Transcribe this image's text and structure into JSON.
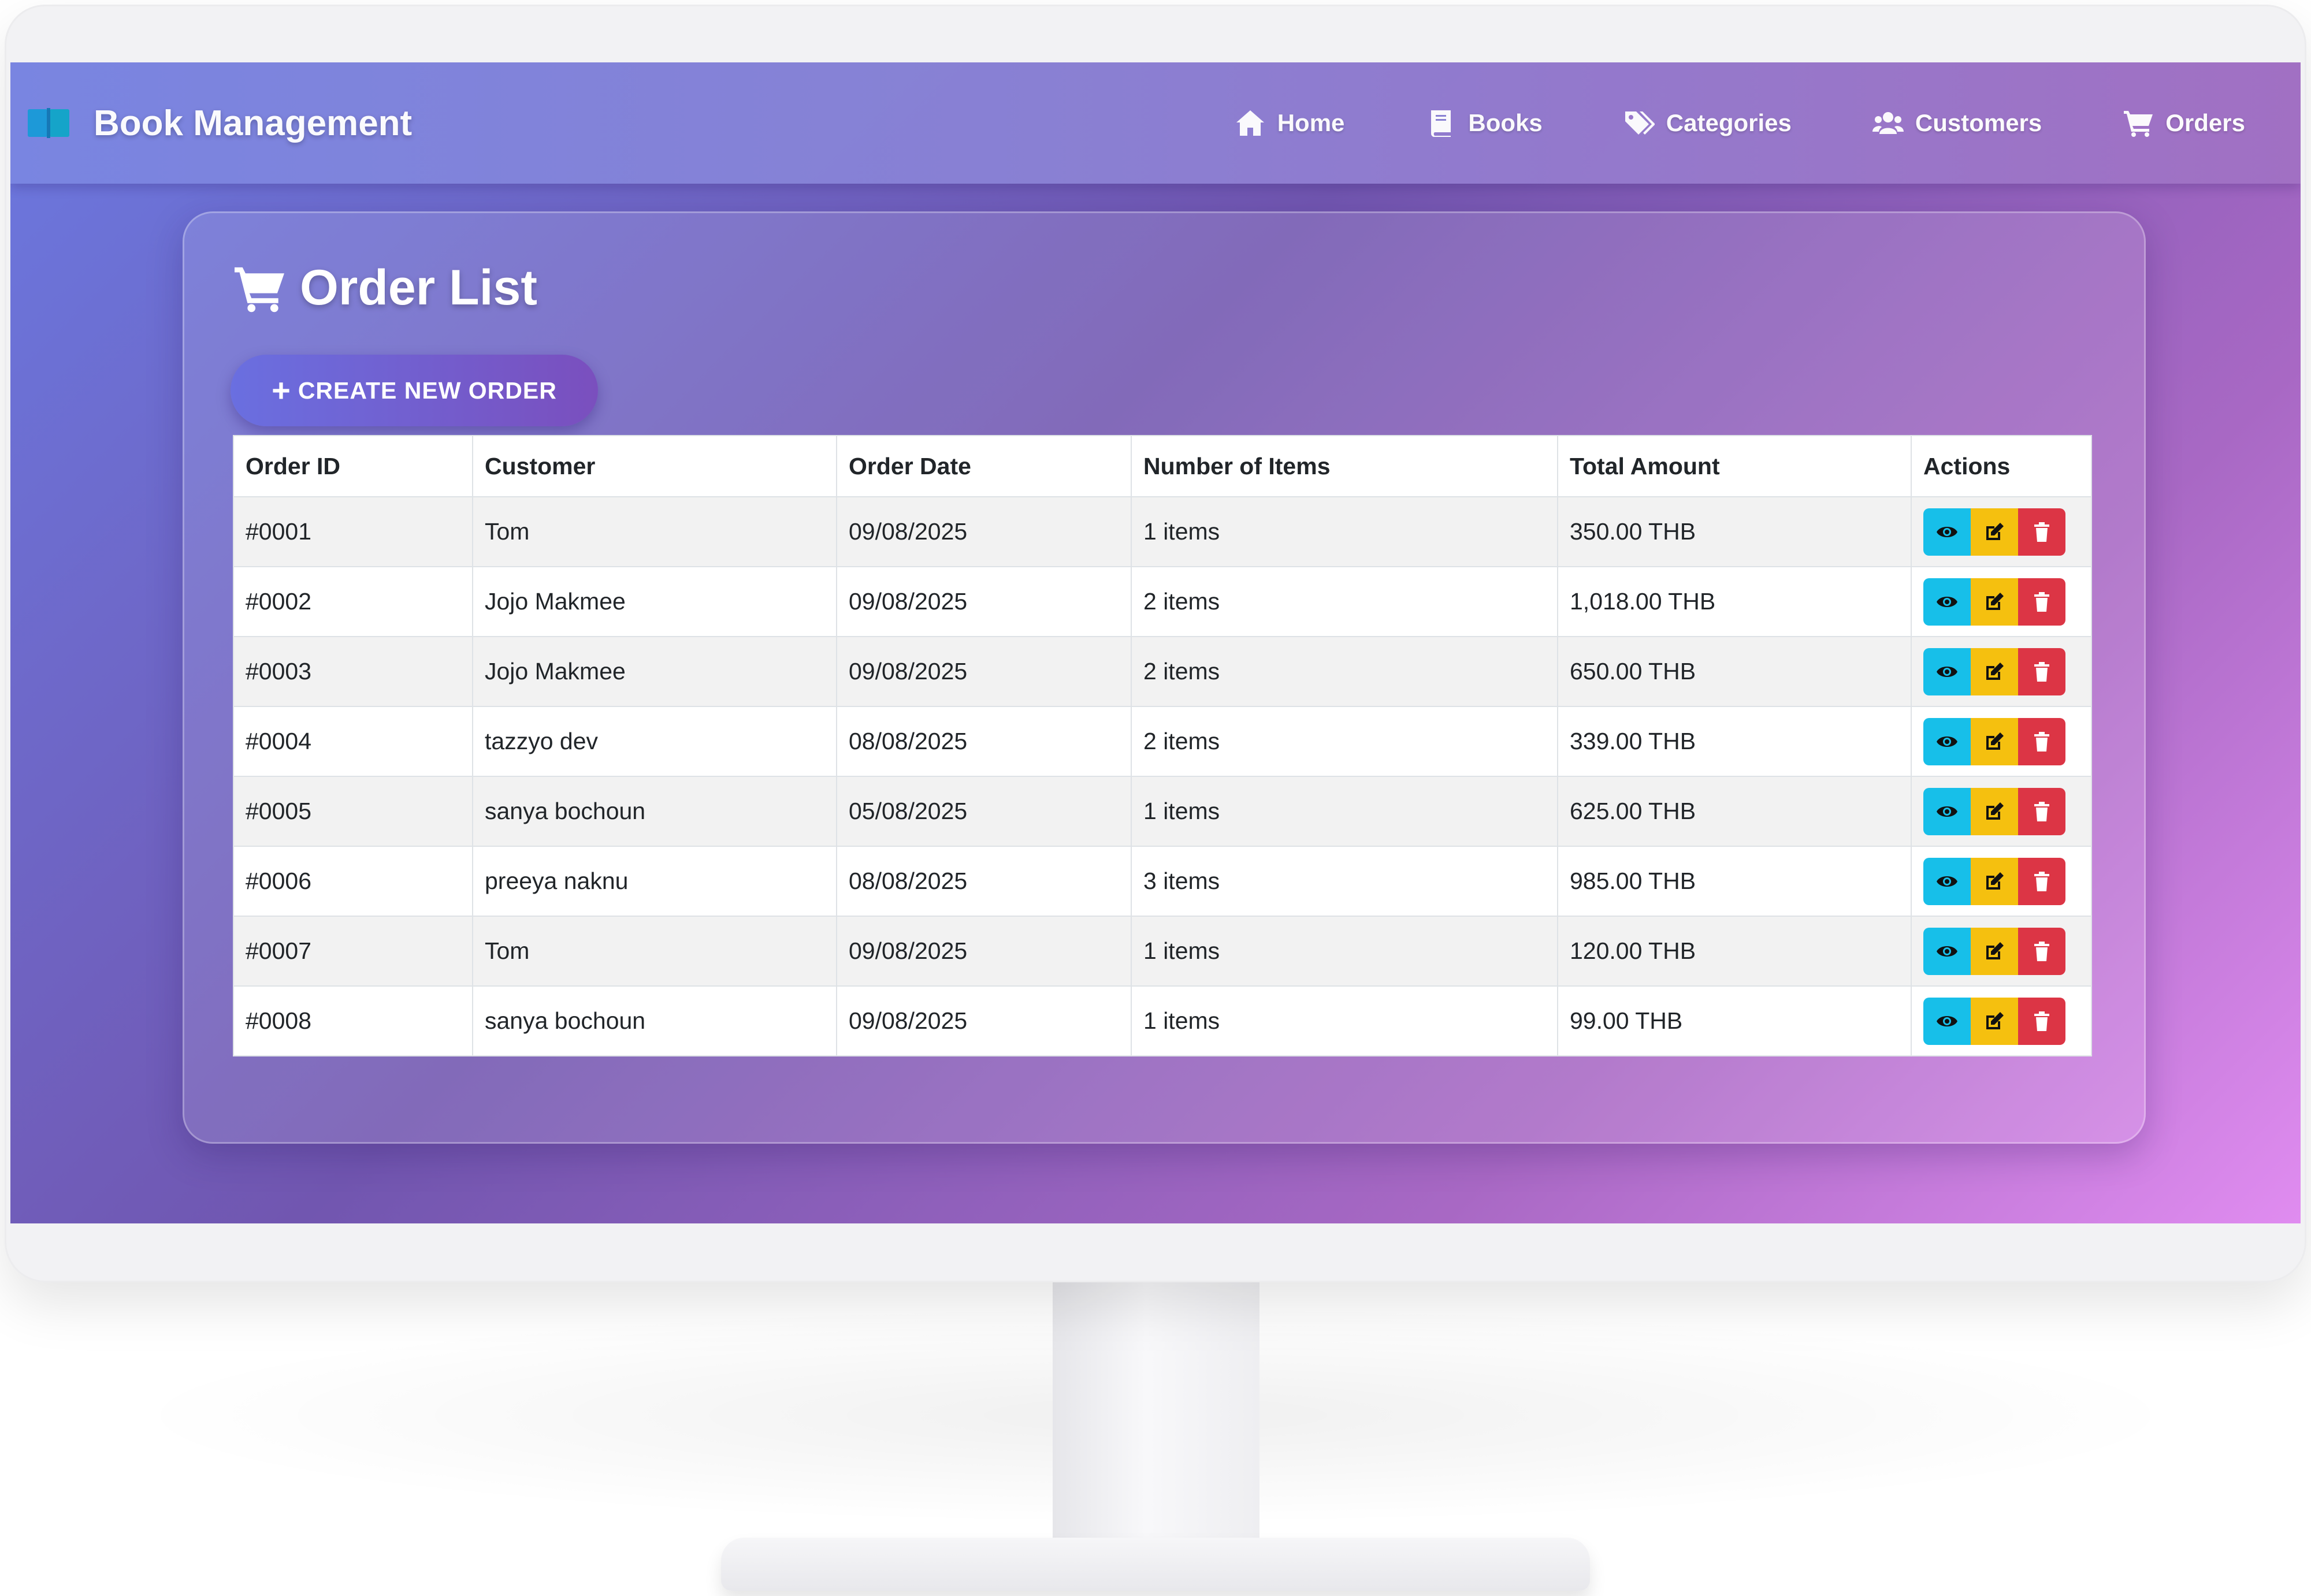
{
  "app": {
    "brand": "Book Management"
  },
  "nav": {
    "items": [
      {
        "label": "Home",
        "icon": "home-icon"
      },
      {
        "label": "Books",
        "icon": "book-icon"
      },
      {
        "label": "Categories",
        "icon": "tags-icon"
      },
      {
        "label": "Customers",
        "icon": "users-icon"
      },
      {
        "label": "Orders",
        "icon": "cart-icon"
      }
    ]
  },
  "page": {
    "title": "Order List",
    "create_button": "CREATE NEW ORDER",
    "create_button_icon": "plus-icon"
  },
  "table": {
    "headers": [
      "Order ID",
      "Customer",
      "Order Date",
      "Number of Items",
      "Total Amount",
      "Actions"
    ],
    "rows": [
      {
        "id": "#0001",
        "customer": "Tom",
        "date": "09/08/2025",
        "items": "1 items",
        "total": "350.00 THB"
      },
      {
        "id": "#0002",
        "customer": "Jojo Makmee",
        "date": "09/08/2025",
        "items": "2 items",
        "total": "1,018.00 THB"
      },
      {
        "id": "#0003",
        "customer": "Jojo Makmee",
        "date": "09/08/2025",
        "items": "2 items",
        "total": "650.00 THB"
      },
      {
        "id": "#0004",
        "customer": "tazzyo dev",
        "date": "08/08/2025",
        "items": "2 items",
        "total": "339.00 THB"
      },
      {
        "id": "#0005",
        "customer": "sanya bochoun",
        "date": "05/08/2025",
        "items": "1 items",
        "total": "625.00 THB"
      },
      {
        "id": "#0006",
        "customer": "preeya naknu",
        "date": "08/08/2025",
        "items": "3 items",
        "total": "985.00 THB"
      },
      {
        "id": "#0007",
        "customer": "Tom",
        "date": "09/08/2025",
        "items": "1 items",
        "total": "120.00 THB"
      },
      {
        "id": "#0008",
        "customer": "sanya bochoun",
        "date": "09/08/2025",
        "items": "1 items",
        "total": "99.00 THB"
      }
    ],
    "row_actions": [
      "eye-icon",
      "edit-icon",
      "trash-icon"
    ]
  },
  "colors": {
    "view_button": "#17bfe9",
    "edit_button": "#f5c00f",
    "delete_button": "#dc3545",
    "gradient_start": "#6b78df",
    "gradient_end": "#e08cf0"
  }
}
